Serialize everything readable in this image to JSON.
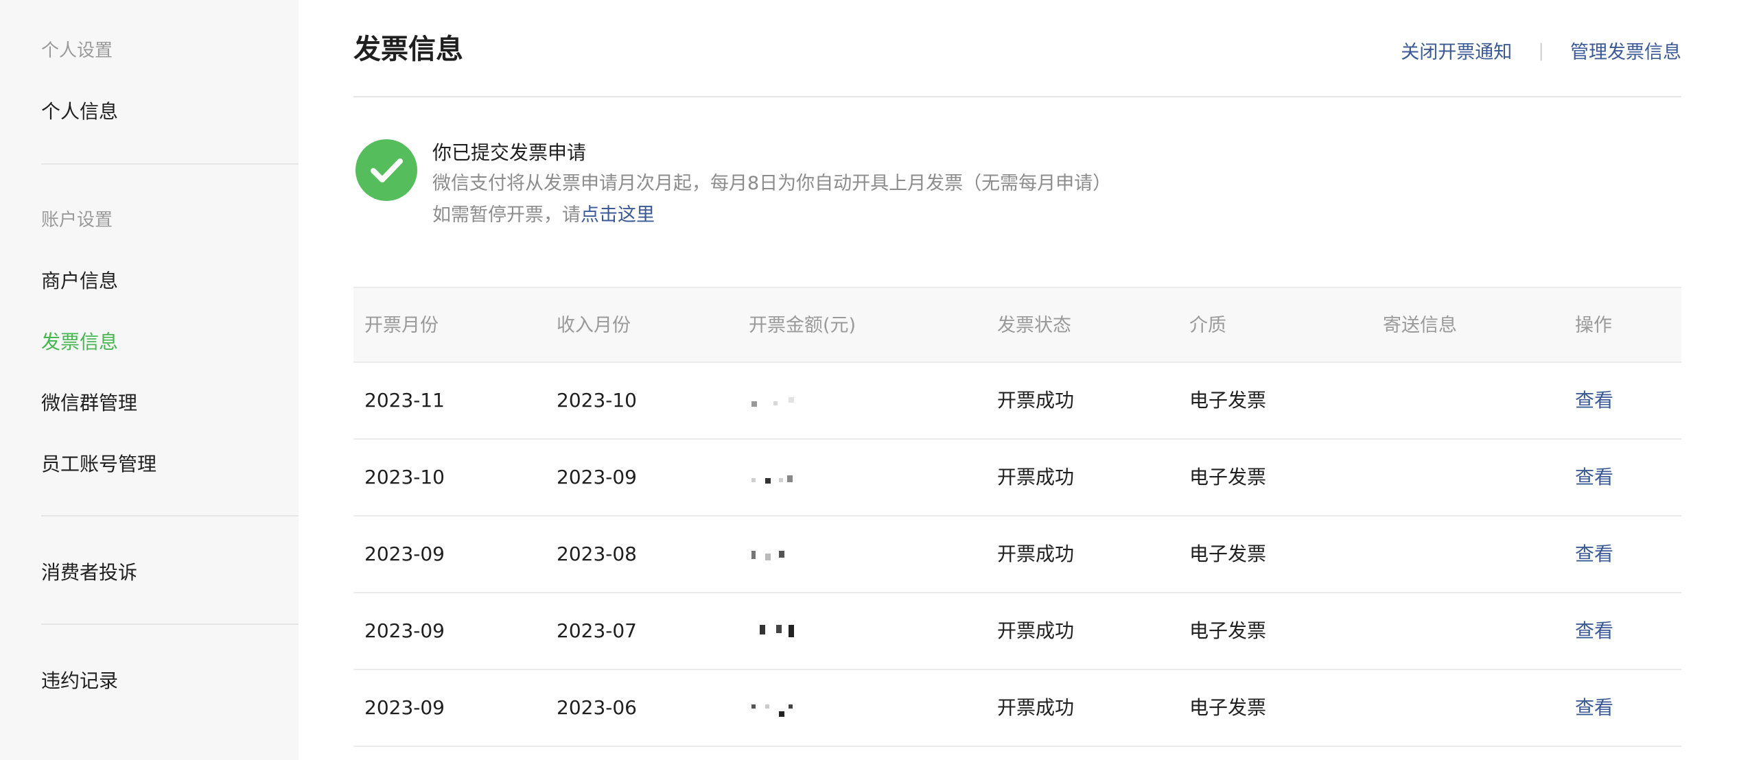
{
  "sidebar": {
    "groups": [
      {
        "title": "个人设置",
        "items": [
          {
            "label": "个人信息",
            "active": false
          }
        ]
      },
      {
        "title": "账户设置",
        "items": [
          {
            "label": "商户信息",
            "active": false
          },
          {
            "label": "发票信息",
            "active": true
          },
          {
            "label": "微信群管理",
            "active": false
          },
          {
            "label": "员工账号管理",
            "active": false
          }
        ]
      },
      {
        "items": [
          {
            "label": "消费者投诉",
            "active": false
          }
        ]
      },
      {
        "items": [
          {
            "label": "违约记录",
            "active": false
          }
        ]
      }
    ],
    "active_color": "#46b650"
  },
  "header": {
    "title": "发票信息",
    "links": [
      "关闭开票通知",
      "管理发票信息"
    ]
  },
  "notice": {
    "title": "你已提交发票申请",
    "description": "微信支付将从发票申请月次月起，每月8日为你自动开具上月发票（无需每月申请）",
    "pause_prefix": "如需暂停开票，请",
    "pause_link": "点击这里",
    "icon": "check-circle-icon",
    "icon_color": "#55bd5c"
  },
  "table": {
    "columns": [
      "开票月份",
      "收入月份",
      "开票金额(元)",
      "发票状态",
      "介质",
      "寄送信息",
      "操作"
    ],
    "rows": [
      {
        "invoice_month": "2023-11",
        "income_month": "2023-10",
        "status": "开票成功",
        "medium": "电子发票",
        "action": "查看"
      },
      {
        "invoice_month": "2023-10",
        "income_month": "2023-09",
        "status": "开票成功",
        "medium": "电子发票",
        "action": "查看"
      },
      {
        "invoice_month": "2023-09",
        "income_month": "2023-08",
        "status": "开票成功",
        "medium": "电子发票",
        "action": "查看"
      },
      {
        "invoice_month": "2023-09",
        "income_month": "2023-07",
        "status": "开票成功",
        "medium": "电子发票",
        "action": "查看"
      },
      {
        "invoice_month": "2023-09",
        "income_month": "2023-06",
        "status": "开票成功",
        "medium": "电子发票",
        "action": "查看"
      }
    ]
  },
  "colors": {
    "link": "#3b5a95",
    "muted_text": "#9a9a9a",
    "sidebar_bg": "#f7f7f7"
  }
}
